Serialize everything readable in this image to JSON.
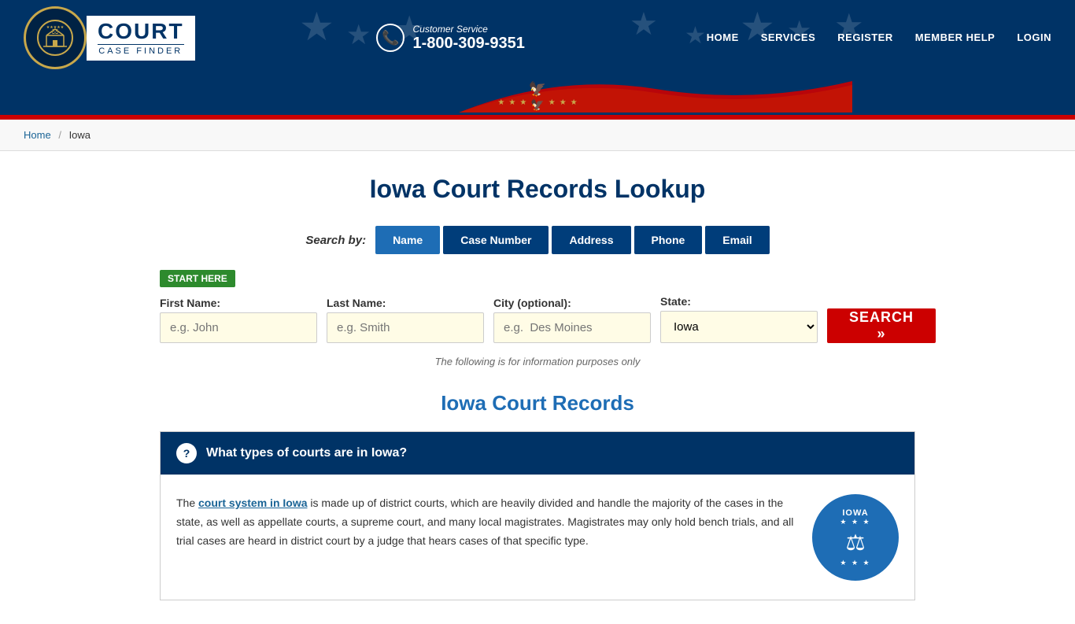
{
  "header": {
    "customer_service_label": "Customer Service",
    "phone": "1-800-309-9351",
    "nav": [
      "HOME",
      "SERVICES",
      "REGISTER",
      "MEMBER HELP",
      "LOGIN"
    ]
  },
  "breadcrumb": {
    "home": "Home",
    "separator": "/",
    "current": "Iowa"
  },
  "page": {
    "title": "Iowa Court Records Lookup",
    "disclaimer": "The following is for information purposes only",
    "section_title": "Iowa Court Records"
  },
  "search": {
    "by_label": "Search by:",
    "tabs": [
      {
        "label": "Name",
        "active": true
      },
      {
        "label": "Case Number",
        "active": false
      },
      {
        "label": "Address",
        "active": false
      },
      {
        "label": "Phone",
        "active": false
      },
      {
        "label": "Email",
        "active": false
      }
    ],
    "start_here": "START HERE",
    "fields": {
      "first_name_label": "First Name:",
      "first_name_placeholder": "e.g. John",
      "last_name_label": "Last Name:",
      "last_name_placeholder": "e.g. Smith",
      "city_label": "City (optional):",
      "city_placeholder": "e.g.  Des Moines",
      "state_label": "State:",
      "state_value": "Iowa"
    },
    "button": "SEARCH »"
  },
  "faq": [
    {
      "question": "What types of courts are in Iowa?",
      "answer": "The court system in Iowa is made up of district courts, which are heavily divided and handle the majority of the cases in the state, as well as appellate courts, a supreme court, and many local magistrates. Magistrates may only hold bench trials, and all trial cases are heard in district court by a judge that hears cases of that specific type.",
      "link_text": "court system in Iowa"
    }
  ],
  "seal": {
    "text": "IOWA",
    "stars": "★ ★ ★"
  }
}
